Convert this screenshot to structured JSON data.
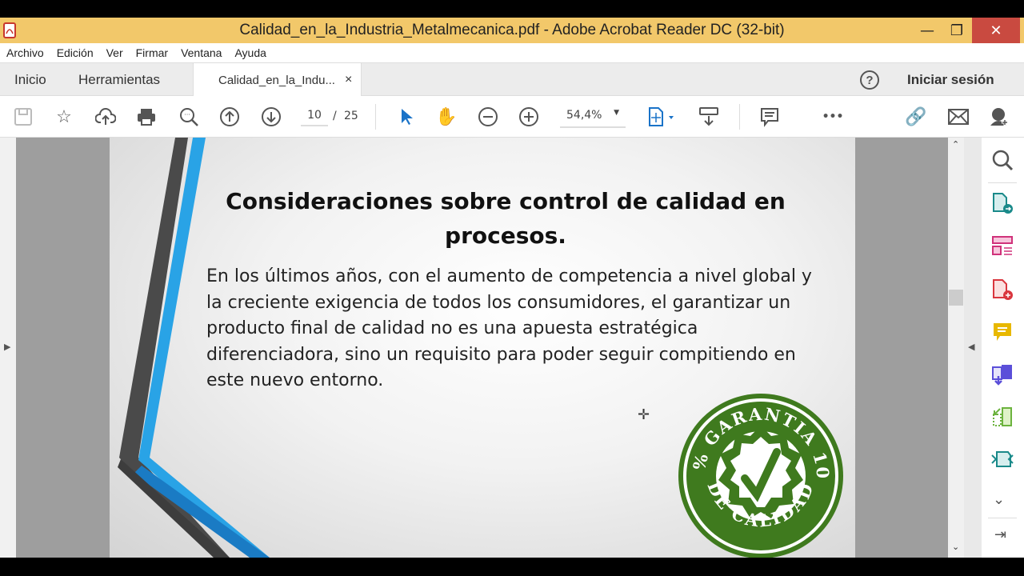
{
  "window": {
    "title": "Calidad_en_la_Industria_Metalmecanica.pdf - Adobe Acrobat Reader DC (32-bit)",
    "minimize": "—",
    "maximize": "❐",
    "close": "✕"
  },
  "menu": [
    "Archivo",
    "Edición",
    "Ver",
    "Firmar",
    "Ventana",
    "Ayuda"
  ],
  "tabs": {
    "home": "Inicio",
    "tools": "Herramientas",
    "document": "Calidad_en_la_Indu...",
    "close": "×",
    "help": "?",
    "signin": "Iniciar sesión"
  },
  "toolbar": {
    "page_current": "10",
    "page_sep": "/",
    "page_total": "25",
    "zoom": "54,4%",
    "more": "•••"
  },
  "document": {
    "title": "Consideraciones sobre control de calidad en procesos.",
    "paragraph": "En los últimos años, con el aumento de competencia a nivel global y la creciente exigencia de todos los consumidores, el garantizar un producto final de calidad no es una apuesta estratégica diferenciadora, sino un requisito para poder seguir compitiendo en este nuevo entorno.",
    "stamp": {
      "top": "GARANTIA",
      "left": "100%",
      "right": "100%",
      "bottom": "DE CALIDAD",
      "color": "#3f7a1e"
    }
  },
  "colors": {
    "titlebar": "#f2c86a",
    "accent_blue": "#1a73c8",
    "stripe_blue": "#29a3e6",
    "stripe_dark": "#4a4a4a"
  }
}
